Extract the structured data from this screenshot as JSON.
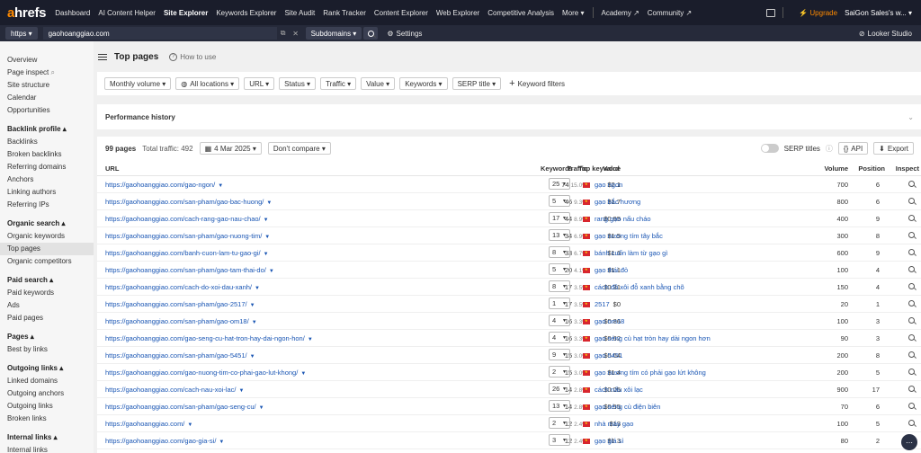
{
  "brand": {
    "a": "a",
    "rest": "hrefs"
  },
  "topnav": {
    "items": [
      "Dashboard",
      "AI Content Helper",
      "Site Explorer",
      "Keywords Explorer",
      "Site Audit",
      "Rank Tracker",
      "Content Explorer",
      "Web Explorer",
      "Competitive Analysis",
      "More ▾"
    ],
    "items2": [
      "Academy ↗",
      "Community ↗"
    ],
    "upgrade": "⚡ Upgrade",
    "account": "SaiGon Sales's w... ▾"
  },
  "urlbar": {
    "protocol": "https ▾",
    "target": "gaohoanggiao.com",
    "mode": "Subdomains ▾",
    "settings": "Settings",
    "looker": "Looker Studio"
  },
  "sidebar": {
    "top": [
      "Overview",
      "Page inspect",
      "Site structure",
      "Calendar",
      "Opportunities"
    ],
    "sections": [
      {
        "title": "Backlink profile ▴",
        "items": [
          "Backlinks",
          "Broken backlinks",
          "Referring domains",
          "Anchors",
          "Linking authors",
          "Referring IPs"
        ]
      },
      {
        "title": "Organic search ▴",
        "items": [
          "Organic keywords",
          "Top pages",
          "Organic competitors"
        ]
      },
      {
        "title": "Paid search ▴",
        "items": [
          "Paid keywords",
          "Ads",
          "Paid pages"
        ]
      },
      {
        "title": "Pages ▴",
        "items": [
          "Best by links"
        ]
      },
      {
        "title": "Outgoing links ▴",
        "items": [
          "Linked domains",
          "Outgoing anchors",
          "Outgoing links",
          "Broken links"
        ]
      },
      {
        "title": "Internal links ▴",
        "items": [
          "Internal links"
        ]
      }
    ]
  },
  "page": {
    "title": "Top pages",
    "howto": "How to use"
  },
  "filters": [
    "Monthly volume ▾",
    "All locations ▾",
    "URL ▾",
    "Status ▾",
    "Traffic ▾",
    "Value ▾",
    "Keywords ▾",
    "SERP title ▾"
  ],
  "keyword_filters": "Keyword filters",
  "perf": {
    "title": "Performance history"
  },
  "table": {
    "pages": "99 pages",
    "total_traffic": "Total traffic: 492",
    "date": "4 Mar 2025 ▾",
    "compare": "Don't compare ▾",
    "serp_titles": "SERP titles",
    "api": "API",
    "export": "Export",
    "headers": {
      "url": "URL",
      "traffic": "Traffic",
      "value": "Value",
      "keywords": "Keywords",
      "top": "Top keyword",
      "volume": "Volume",
      "position": "Position",
      "inspect": "Inspect"
    },
    "rows": [
      {
        "url": "https://gaohoanggiao.com/gao-ngon/",
        "traffic": "74",
        "pct": "15.0%",
        "value": "$2.1",
        "kw": "25",
        "top": "gạo ngon",
        "vol": "700",
        "pos": "6"
      },
      {
        "url": "https://gaohoanggiao.com/san-pham/gao-bac-huong/",
        "traffic": "46",
        "pct": "9.3%",
        "value": "$1.7",
        "kw": "5",
        "top": "gạo bắc hương",
        "vol": "800",
        "pos": "6"
      },
      {
        "url": "https://gaohoanggiao.com/cach-rang-gao-nau-chao/",
        "traffic": "44",
        "pct": "8.9%",
        "value": "$0.95",
        "kw": "17",
        "top": "rang gạo nấu cháo",
        "vol": "400",
        "pos": "9"
      },
      {
        "url": "https://gaohoanggiao.com/san-pham/gao-nuong-tim/",
        "traffic": "34",
        "pct": "6.9%",
        "value": "$1.5",
        "kw": "13",
        "top": "gạo nương tím tây bắc",
        "vol": "300",
        "pos": "8"
      },
      {
        "url": "https://gaohoanggiao.com/banh-cuon-lam-tu-gao-gi/",
        "traffic": "33",
        "pct": "6.7%",
        "value": "$1.6",
        "kw": "8",
        "top": "bánh cuốn làm từ gạo gì",
        "vol": "600",
        "pos": "9"
      },
      {
        "url": "https://gaohoanggiao.com/san-pham/gao-tam-thai-do/",
        "traffic": "20",
        "pct": "4.1%",
        "value": "$1.1",
        "kw": "5",
        "top": "gạo thái đỏ",
        "vol": "100",
        "pos": "4"
      },
      {
        "url": "https://gaohoanggiao.com/cach-do-xoi-dau-xanh/",
        "traffic": "17",
        "pct": "3.5%",
        "value": "$0.31",
        "kw": "8",
        "top": "cách đồ xôi đỗ xanh bằng chõ",
        "vol": "150",
        "pos": "4"
      },
      {
        "url": "https://gaohoanggiao.com/san-pham/gao-2517/",
        "traffic": "17",
        "pct": "3.5%",
        "value": "$0",
        "kw": "1",
        "top": "2517",
        "vol": "20",
        "pos": "1"
      },
      {
        "url": "https://gaohoanggiao.com/san-pham/gao-om18/",
        "traffic": "16",
        "pct": "3.3%",
        "value": "$0.86",
        "kw": "4",
        "top": "gạo om18",
        "vol": "100",
        "pos": "3"
      },
      {
        "url": "https://gaohoanggiao.com/gao-seng-cu-hat-tron-hay-dai-ngon-hon/",
        "traffic": "16",
        "pct": "3.3%",
        "value": "$0.62",
        "kw": "4",
        "top": "gạo séng cù hạt tròn hay dài ngon hơn",
        "vol": "90",
        "pos": "3"
      },
      {
        "url": "https://gaohoanggiao.com/san-pham/gao-5451/",
        "traffic": "15",
        "pct": "3.0%",
        "value": "$0.64",
        "kw": "9",
        "top": "gạo 5451",
        "vol": "200",
        "pos": "8"
      },
      {
        "url": "https://gaohoanggiao.com/gao-nuong-tim-co-phai-gao-lut-khong/",
        "traffic": "15",
        "pct": "3.0%",
        "value": "$1.4",
        "kw": "2",
        "top": "gạo nương tím có phải gạo lứt không",
        "vol": "200",
        "pos": "5"
      },
      {
        "url": "https://gaohoanggiao.com/cach-nau-xoi-lac/",
        "traffic": "14",
        "pct": "2.8%",
        "value": "$0.05",
        "kw": "26",
        "top": "cách nấu xôi lạc",
        "vol": "900",
        "pos": "17"
      },
      {
        "url": "https://gaohoanggiao.com/san-pham/gao-seng-cu/",
        "traffic": "14",
        "pct": "2.8%",
        "value": "$0.55",
        "kw": "13",
        "top": "gạo séng cù điện biên",
        "vol": "70",
        "pos": "6"
      },
      {
        "url": "https://gaohoanggiao.com/",
        "traffic": "12",
        "pct": "2.4%",
        "value": "$13",
        "kw": "2",
        "top": "nhà máy gạo",
        "vol": "100",
        "pos": "5"
      },
      {
        "url": "https://gaohoanggiao.com/gao-gia-si/",
        "traffic": "12",
        "pct": "2.4%",
        "value": "$1.3",
        "kw": "3",
        "top": "gạo giá sỉ",
        "vol": "80",
        "pos": "2"
      }
    ]
  }
}
